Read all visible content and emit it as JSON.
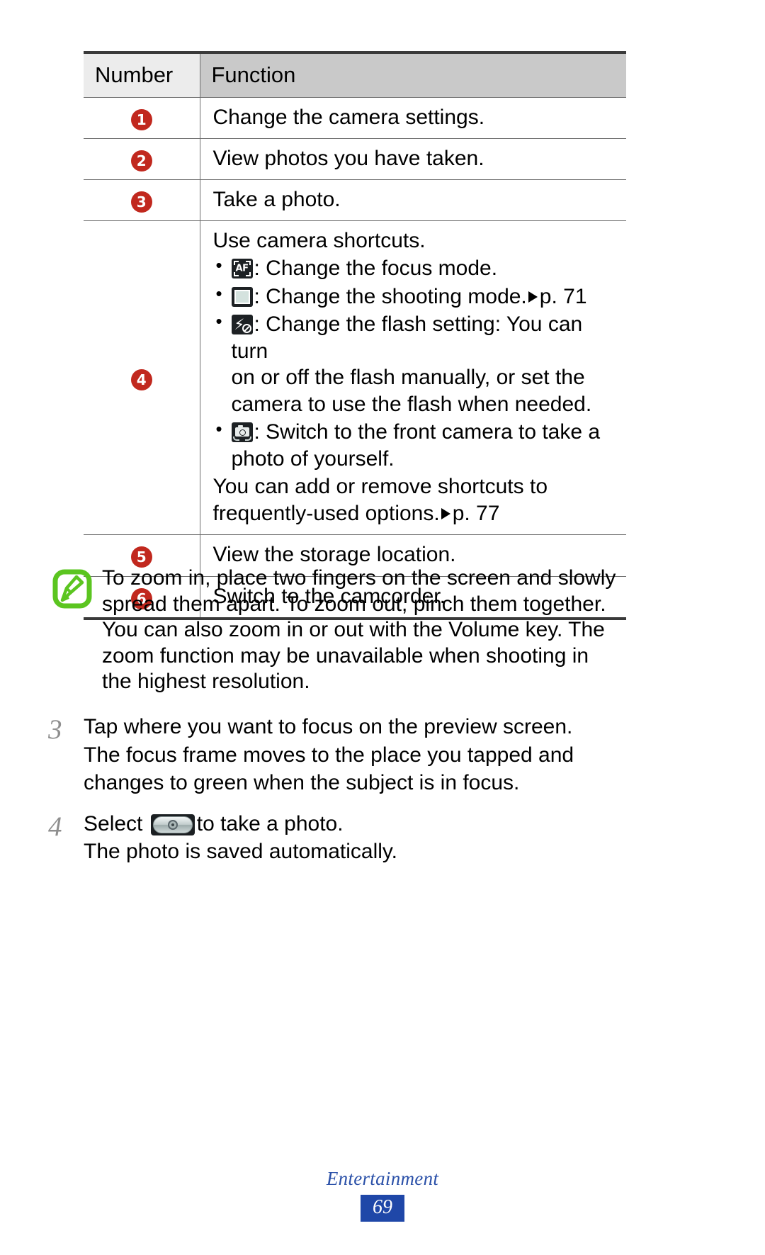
{
  "table": {
    "headers": {
      "number": "Number",
      "function": "Function"
    },
    "rows": [
      {
        "num": "1",
        "text": "Change the camera settings."
      },
      {
        "num": "2",
        "text": "View photos you have taken."
      },
      {
        "num": "3",
        "text": "Take a photo."
      },
      {
        "num": "4",
        "heading": "Use camera shortcuts.",
        "bullets": [
          {
            "icon": "autofocus-icon",
            "text": ": Change the focus mode."
          },
          {
            "icon": "shooting-mode-icon",
            "text": ": Change the shooting mode.",
            "ref": "p. 71"
          },
          {
            "icon": "flash-off-icon",
            "text": ": Change the flash setting: You can turn",
            "cont": [
              "on or off the flash manually, or set the",
              "camera to use the flash when needed."
            ]
          },
          {
            "icon": "switch-camera-icon",
            "text": ": Switch to the front camera to take a",
            "cont": [
              "photo of yourself."
            ]
          }
        ],
        "tail": [
          "You can add or remove shortcuts to"
        ],
        "tail_last": "frequently-used options.",
        "tail_ref": "p. 77"
      },
      {
        "num": "5",
        "text": "View the storage location."
      },
      {
        "num": "6",
        "text": "Switch to the camcorder."
      }
    ]
  },
  "note": {
    "icon": "note-icon",
    "lines": [
      "To zoom in, place two fingers on the screen and slowly",
      "spread them apart. To zoom out, pinch them together.",
      "You can also zoom in or out with the Volume key. The",
      "zoom function may be unavailable when shooting in",
      "the highest resolution."
    ]
  },
  "steps": [
    {
      "number": "3",
      "lines": [
        "Tap where you want to focus on the preview screen.",
        "The focus frame moves to the place you tapped and",
        "changes to green when the subject is in focus."
      ]
    },
    {
      "number": "4",
      "select_label": "Select",
      "icon": "shutter-button-icon",
      "after_icon": "to take a photo.",
      "lines": [
        "The photo is saved automatically."
      ]
    }
  ],
  "footer": {
    "chapter": "Entertainment",
    "page": "69"
  },
  "colors": {
    "badge_red": "#c1281e",
    "header_light": "#ececec",
    "header_dark": "#c9c9c9",
    "note_green": "#5bc520",
    "footer_blue": "#1f47a8",
    "step_number_gray": "#8e8e8e"
  }
}
